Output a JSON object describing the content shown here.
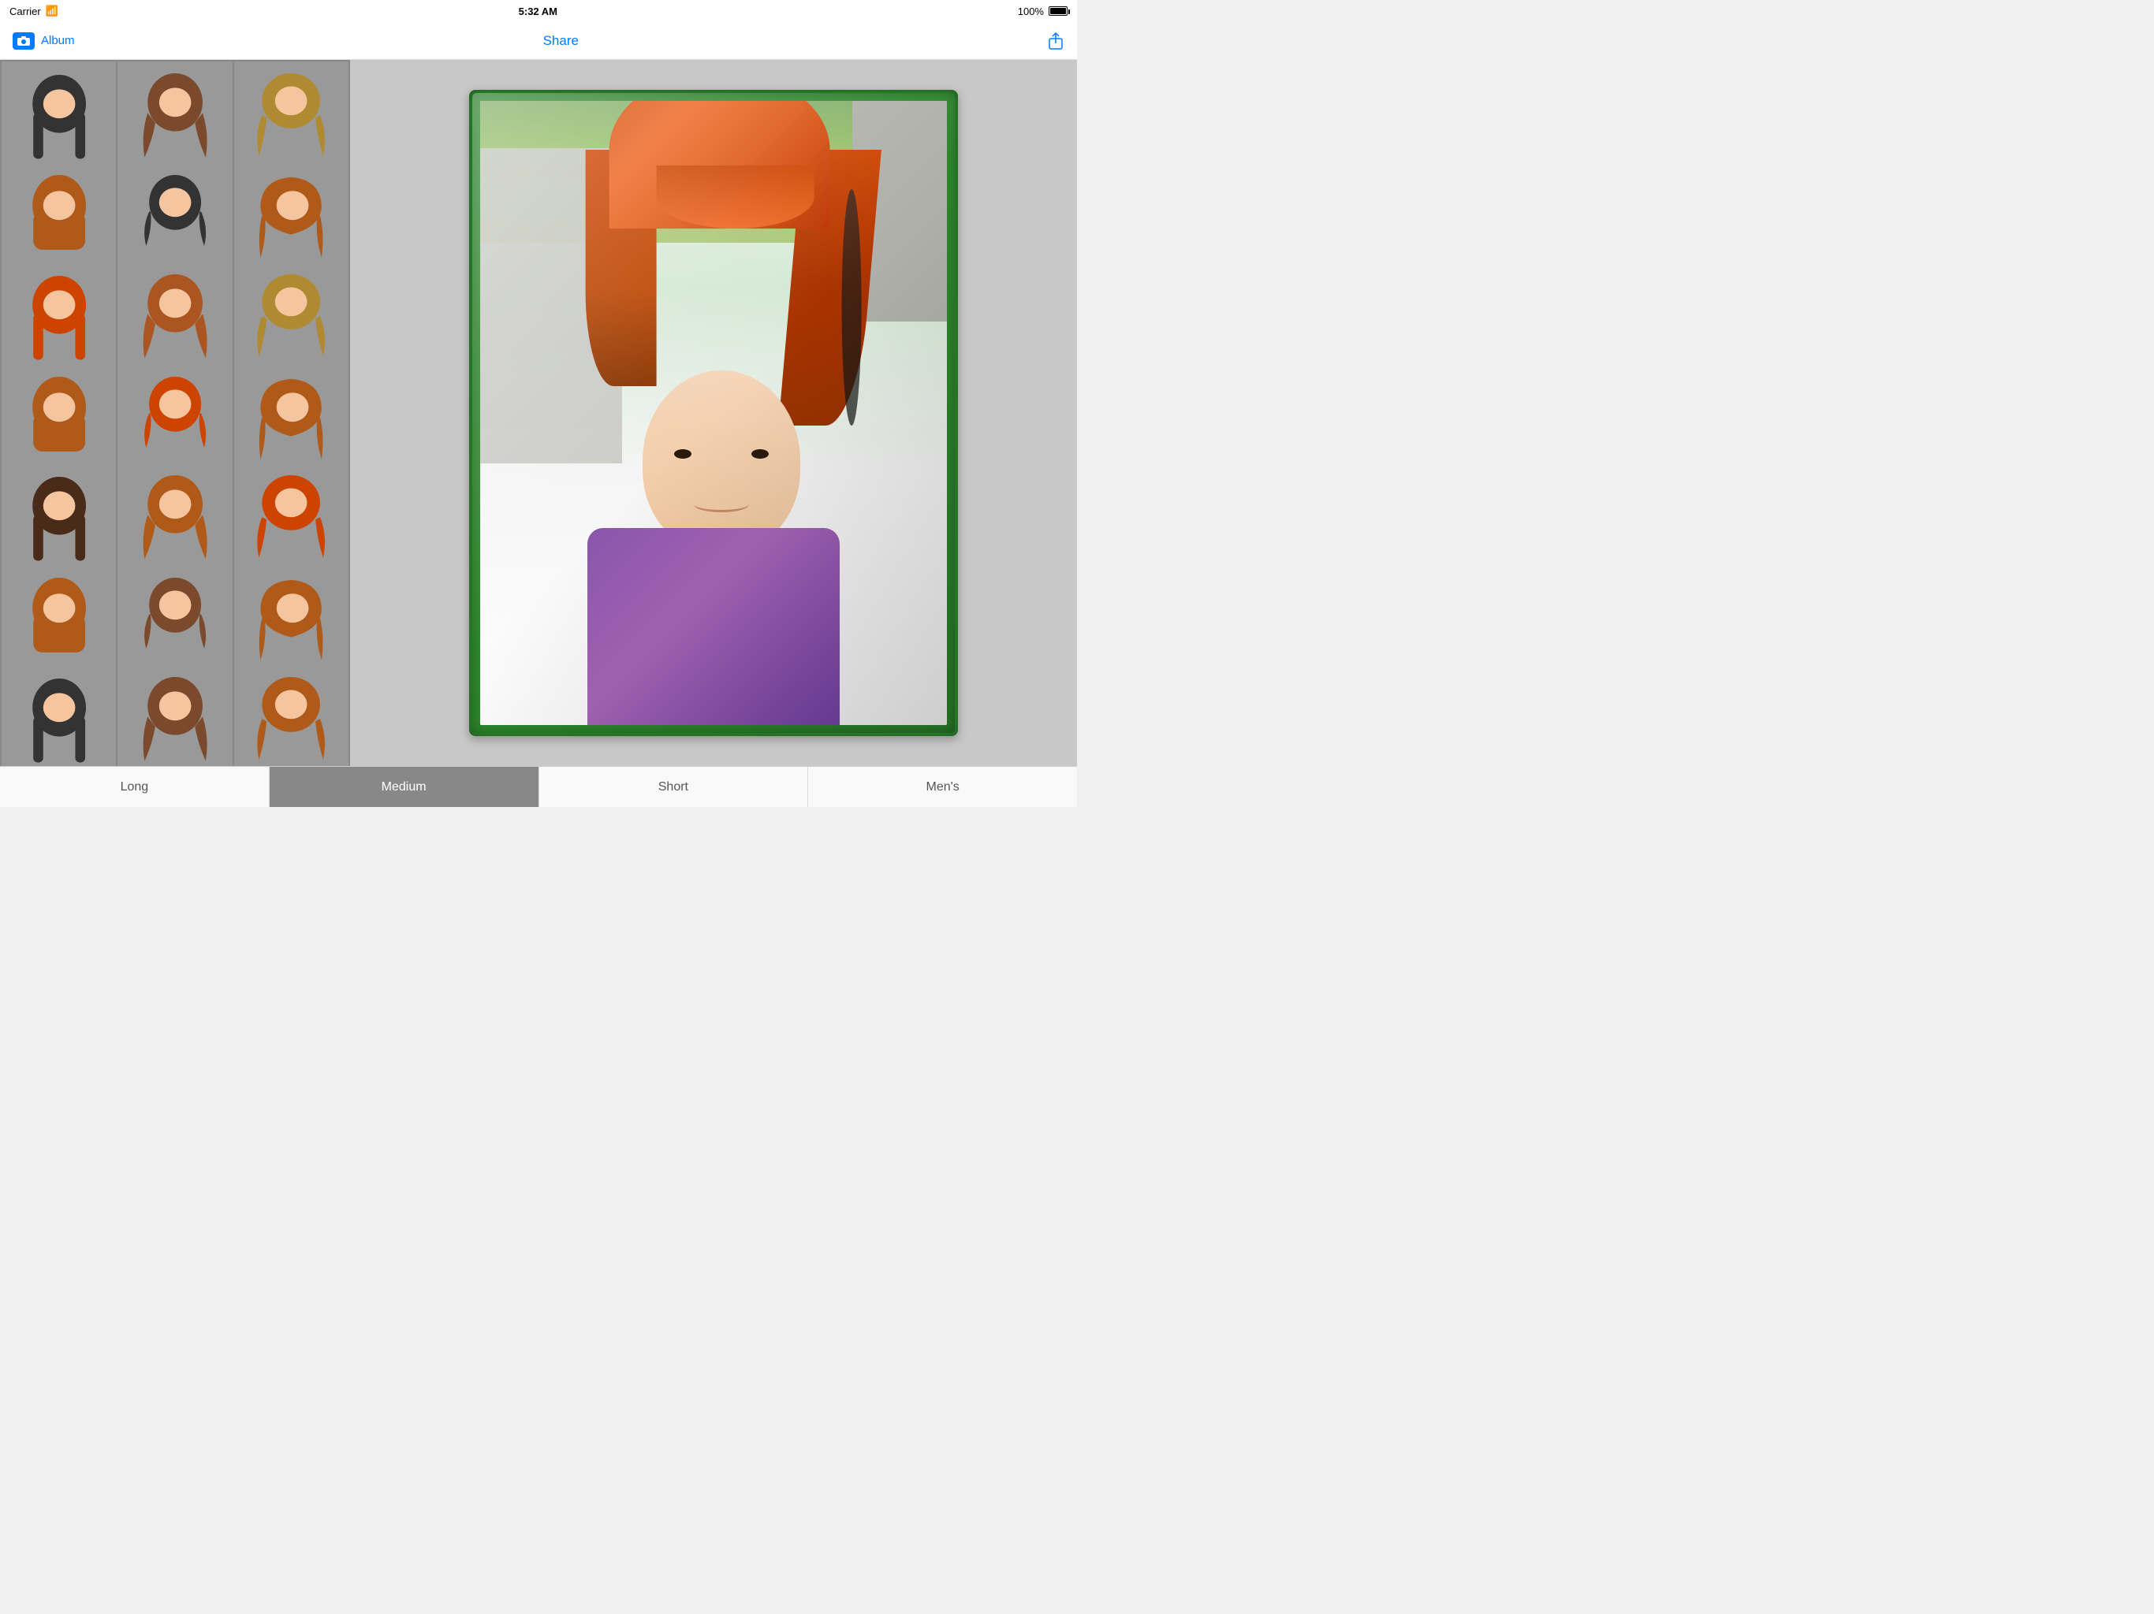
{
  "statusBar": {
    "carrier": "Carrier",
    "wifi": "wifi",
    "time": "5:32 AM",
    "battery": "100%"
  },
  "navBar": {
    "albumLabel": "Album",
    "shareLabel": "Share",
    "cameraIcon": "camera"
  },
  "hairGrid": {
    "items": [
      {
        "id": 1,
        "colorClass": "h-dark"
      },
      {
        "id": 2,
        "colorClass": "h-brown"
      },
      {
        "id": 3,
        "colorClass": "h-golden"
      },
      {
        "id": 4,
        "colorClass": "h-auburn"
      },
      {
        "id": 5,
        "colorClass": "h-dark"
      },
      {
        "id": 6,
        "colorClass": "h-auburn"
      },
      {
        "id": 7,
        "colorClass": "h-red"
      },
      {
        "id": 8,
        "colorClass": "h-copper"
      },
      {
        "id": 9,
        "colorClass": "h-golden"
      },
      {
        "id": 10,
        "colorClass": "h-auburn"
      },
      {
        "id": 11,
        "colorClass": "h-red"
      },
      {
        "id": 12,
        "colorClass": "h-auburn"
      },
      {
        "id": 13,
        "colorClass": "h-darkbrown"
      },
      {
        "id": 14,
        "colorClass": "h-auburn"
      },
      {
        "id": 15,
        "colorClass": "h-red"
      },
      {
        "id": 16,
        "colorClass": "h-auburn"
      },
      {
        "id": 17,
        "colorClass": "h-brown"
      },
      {
        "id": 18,
        "colorClass": "h-auburn"
      },
      {
        "id": 19,
        "colorClass": "h-dark"
      },
      {
        "id": 20,
        "colorClass": "h-brown"
      },
      {
        "id": 21,
        "colorClass": "h-auburn"
      }
    ]
  },
  "tabs": [
    {
      "id": "long",
      "label": "Long",
      "active": false
    },
    {
      "id": "medium",
      "label": "Medium",
      "active": true
    },
    {
      "id": "short",
      "label": "Short",
      "active": false
    },
    {
      "id": "mens",
      "label": "Men's",
      "active": false
    }
  ]
}
